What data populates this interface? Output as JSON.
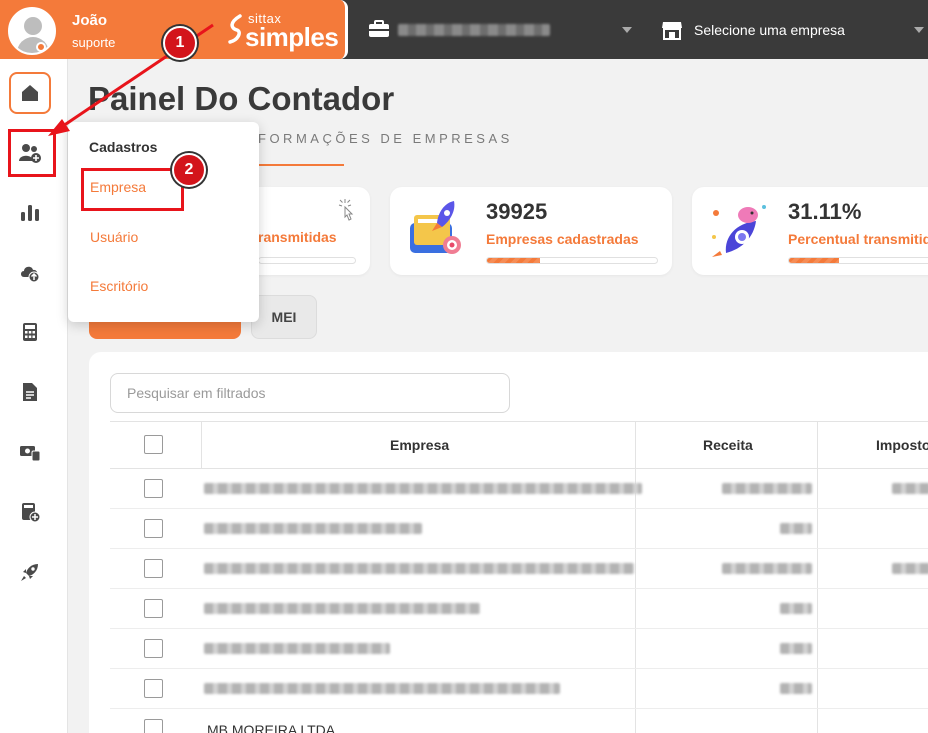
{
  "header": {
    "user_name": "João",
    "user_role": "suporte",
    "logo_small": "sittax",
    "logo_big": "simples",
    "company_placeholder": "Selecione uma empresa"
  },
  "page": {
    "title": "Painel Do Contador",
    "subtitle": "FORMAÇÕES DE EMPRESAS"
  },
  "cards": [
    {
      "value": "",
      "label": "ransmitidas",
      "progress": 0
    },
    {
      "value": "39925",
      "label": "Empresas cadastradas",
      "progress": 0.31
    },
    {
      "value": "31.11%",
      "label": "Percentual transmitido",
      "progress": 0.31
    }
  ],
  "tabs": {
    "mei": "MEI"
  },
  "search": {
    "placeholder": "Pesquisar em filtrados"
  },
  "table": {
    "columns": [
      "Empresa",
      "Receita",
      "Imposto"
    ],
    "rows": [
      {
        "empresa": ""
      },
      {
        "empresa": ""
      },
      {
        "empresa": ""
      },
      {
        "empresa": ""
      },
      {
        "empresa": ""
      },
      {
        "empresa": ""
      },
      {
        "empresa": "MB MOREIRA LTDA"
      }
    ]
  },
  "menu": {
    "heading": "Cadastros",
    "items": [
      "Empresa",
      "Usuário",
      "Escritório"
    ]
  },
  "annotations": {
    "step1": "1",
    "step2": "2"
  },
  "colors": {
    "accent": "#f47a3a",
    "topbar": "#3a3a3a",
    "highlight": "#e8141b"
  }
}
